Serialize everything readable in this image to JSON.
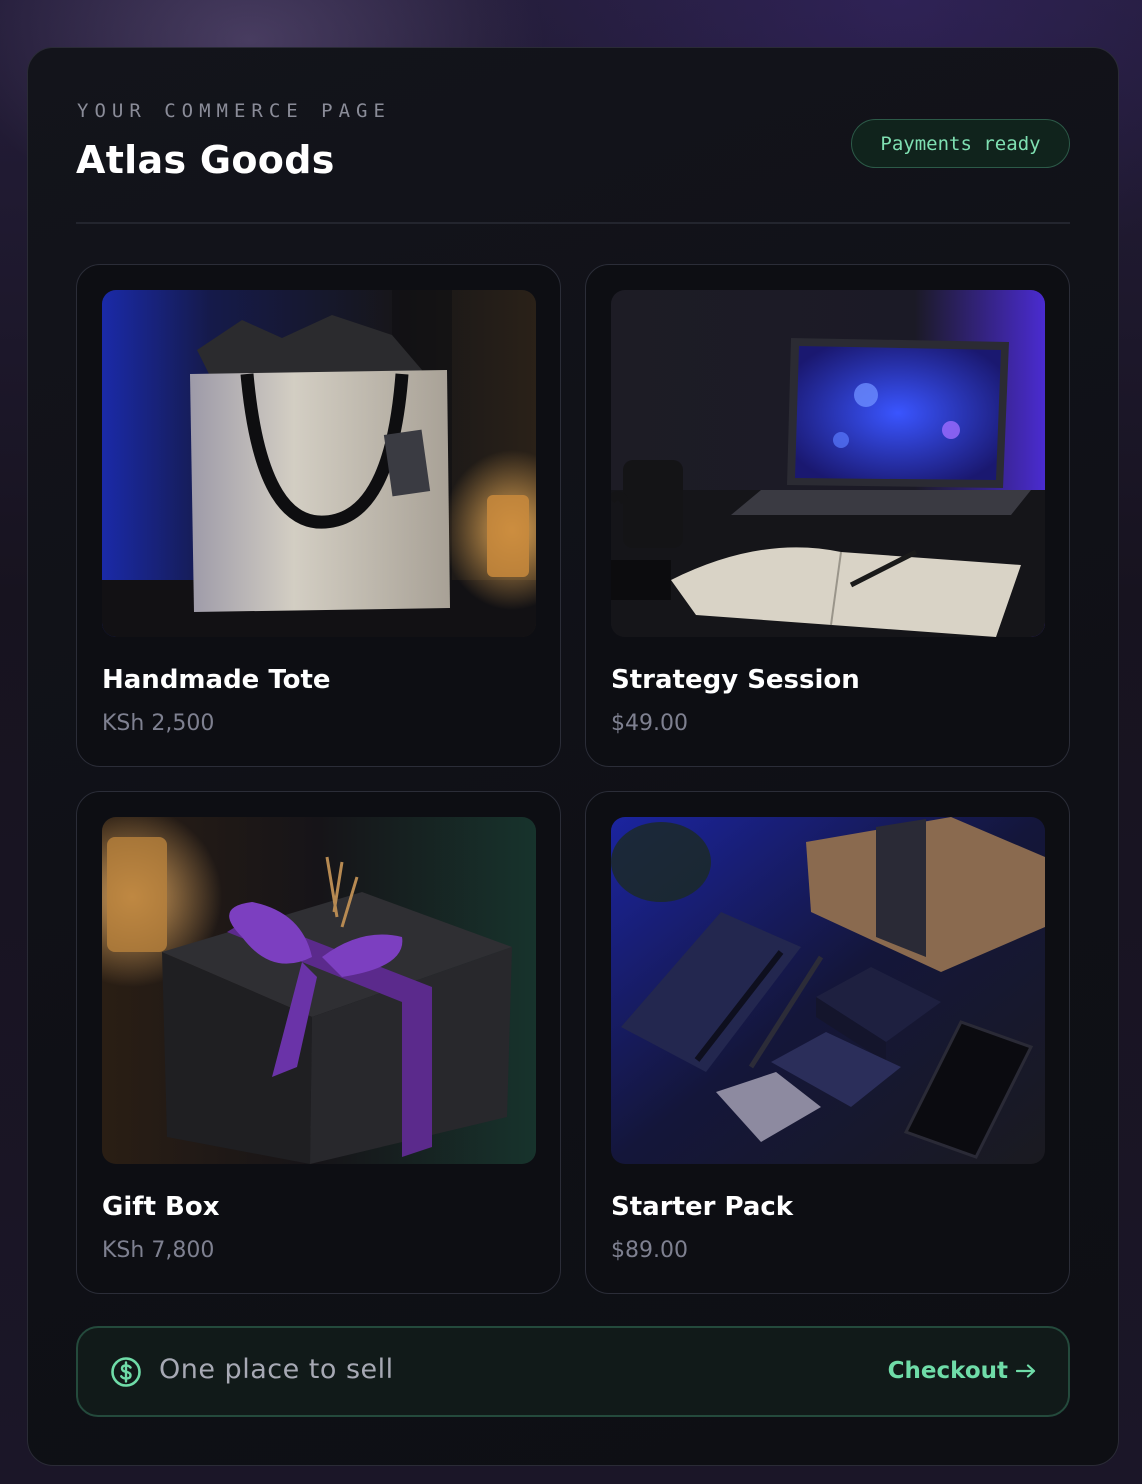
{
  "header": {
    "eyebrow": "YOUR COMMERCE PAGE",
    "store_name": "Atlas Goods",
    "status_badge": "Payments ready"
  },
  "products": [
    {
      "name": "Handmade Tote",
      "price": "KSh 2,500",
      "image": "tote-bag-photo"
    },
    {
      "name": "Strategy Session",
      "price": "$49.00",
      "image": "laptop-notebook-desk-photo"
    },
    {
      "name": "Gift Box",
      "price": "KSh 7,800",
      "image": "gift-box-purple-ribbon-photo"
    },
    {
      "name": "Starter Pack",
      "price": "$89.00",
      "image": "stationery-flatlay-photo"
    }
  ],
  "footer": {
    "icon": "dollar-circle-icon",
    "tagline": "One place to sell",
    "cta_label": "Checkout",
    "cta_icon": "arrow-right-icon"
  },
  "colors": {
    "accent_green": "#6fdca8",
    "panel_bg": "#0f1016",
    "card_border": "#2b2d38"
  }
}
